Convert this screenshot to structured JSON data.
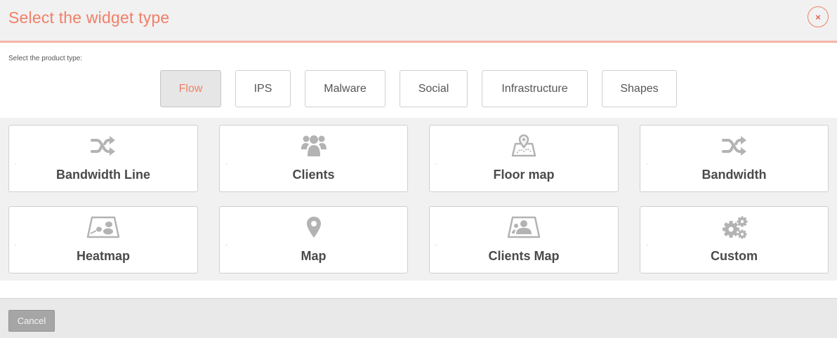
{
  "dialog": {
    "title": "Select the widget type",
    "close_glyph": "×",
    "product_label": "Select the product type:"
  },
  "product_types": [
    {
      "label": "Flow",
      "active": true
    },
    {
      "label": "IPS",
      "active": false
    },
    {
      "label": "Malware",
      "active": false
    },
    {
      "label": "Social",
      "active": false
    },
    {
      "label": "Infrastructure",
      "active": false
    },
    {
      "label": "Shapes",
      "active": false
    }
  ],
  "widgets": [
    {
      "label": "Bandwidth Line",
      "icon": "shuffle-icon"
    },
    {
      "label": "Clients",
      "icon": "users-icon"
    },
    {
      "label": "Floor map",
      "icon": "floor-map-icon"
    },
    {
      "label": "Bandwidth",
      "icon": "shuffle-icon"
    },
    {
      "label": "Heatmap",
      "icon": "heatmap-icon"
    },
    {
      "label": "Map",
      "icon": "map-marker-icon"
    },
    {
      "label": "Clients Map",
      "icon": "clients-map-icon"
    },
    {
      "label": "Custom",
      "icon": "gears-icon"
    }
  ],
  "footer": {
    "cancel_label": "Cancel"
  },
  "colors": {
    "accent": "#f08068",
    "icon_gray": "#b3b3b3",
    "header_bg": "#f1f1f1",
    "header_border": "#f5b5a8"
  }
}
